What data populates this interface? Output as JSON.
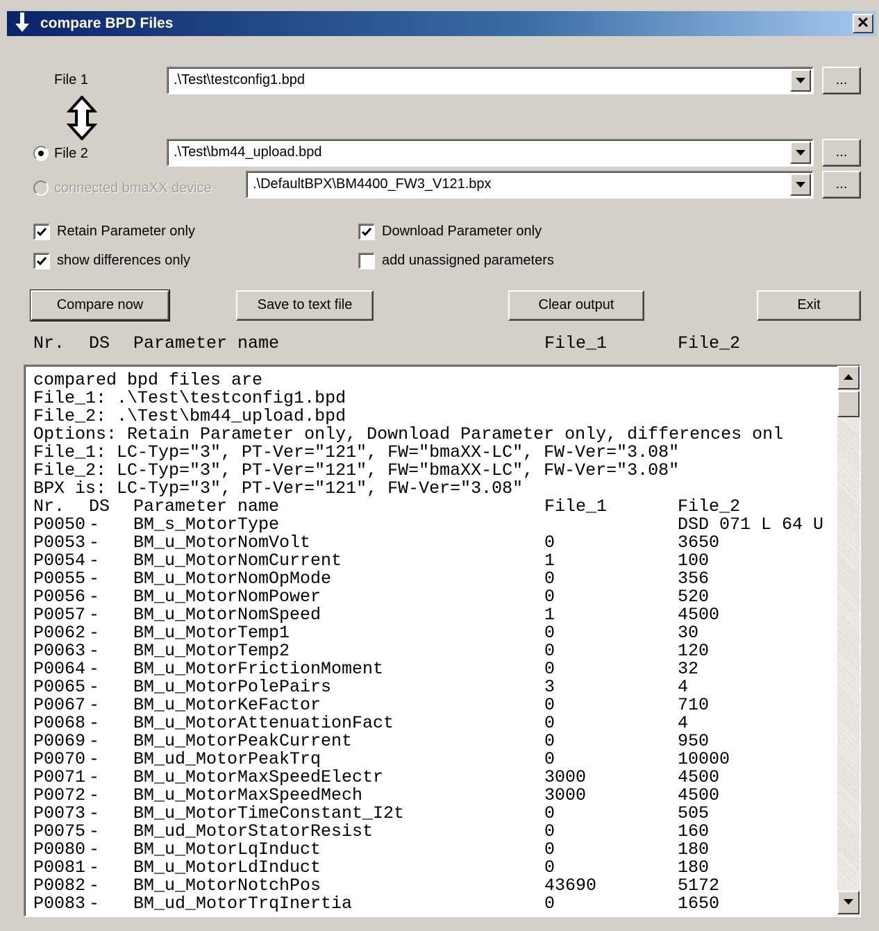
{
  "window": {
    "title": "compare BPD Files",
    "close_label": "✕"
  },
  "file1": {
    "label": "File 1",
    "value": ".\\Test\\testconfig1.bpd",
    "browse_label": "..."
  },
  "file2": {
    "label": "File 2",
    "value": ".\\Test\\bm44_upload.bpd",
    "browse_label": "...",
    "selected": true
  },
  "device": {
    "label": "connected bmaXX device",
    "value": ".\\DefaultBPX\\BM4400_FW3_V121.bpx",
    "browse_label": "...",
    "enabled": false
  },
  "options": {
    "retain": {
      "label": "Retain Parameter only",
      "checked": true
    },
    "download": {
      "label": "Download Parameter only",
      "checked": true
    },
    "differences": {
      "label": "show differences only",
      "checked": true
    },
    "unassigned": {
      "label": "add unassigned parameters",
      "checked": false
    }
  },
  "buttons": {
    "compare": "Compare now",
    "save": "Save to text file",
    "clear": "Clear output",
    "exit": "Exit"
  },
  "columns": {
    "nr": "Nr.",
    "ds": "DS",
    "name": "Parameter name",
    "file1": "File_1",
    "file2": "File_2"
  },
  "output": {
    "preamble": [
      "compared bpd files are",
      "File_1: .\\Test\\testconfig1.bpd",
      "File_2: .\\Test\\bm44_upload.bpd",
      "Options: Retain Parameter only, Download Parameter only, differences onl",
      "File_1: LC-Typ=\"3\", PT-Ver=\"121\", FW=\"bmaXX-LC\", FW-Ver=\"3.08\"",
      "File_2: LC-Typ=\"3\", PT-Ver=\"121\", FW=\"bmaXX-LC\", FW-Ver=\"3.08\"",
      "BPX is: LC-Typ=\"3\", PT-Ver=\"121\", FW-Ver=\"3.08\""
    ],
    "header": {
      "nr": "Nr.",
      "ds": "DS",
      "name": "Parameter name",
      "file1": "File_1",
      "file2": "File_2"
    },
    "rows": [
      {
        "nr": "P0050",
        "ds": "-",
        "name": "BM_s_MotorType",
        "file1": "",
        "file2": "DSD 071 L 64 U"
      },
      {
        "nr": "P0053",
        "ds": "-",
        "name": "BM_u_MotorNomVolt",
        "file1": "0",
        "file2": "3650"
      },
      {
        "nr": "P0054",
        "ds": "-",
        "name": "BM_u_MotorNomCurrent",
        "file1": "1",
        "file2": "100"
      },
      {
        "nr": "P0055",
        "ds": "-",
        "name": "BM_u_MotorNomOpMode",
        "file1": "0",
        "file2": "356"
      },
      {
        "nr": "P0056",
        "ds": "-",
        "name": "BM_u_MotorNomPower",
        "file1": "0",
        "file2": "520"
      },
      {
        "nr": "P0057",
        "ds": "-",
        "name": "BM_u_MotorNomSpeed",
        "file1": "1",
        "file2": "4500"
      },
      {
        "nr": "P0062",
        "ds": "-",
        "name": "BM_u_MotorTemp1",
        "file1": "0",
        "file2": "30"
      },
      {
        "nr": "P0063",
        "ds": "-",
        "name": "BM_u_MotorTemp2",
        "file1": "0",
        "file2": "120"
      },
      {
        "nr": "P0064",
        "ds": "-",
        "name": "BM_u_MotorFrictionMoment",
        "file1": "0",
        "file2": "32"
      },
      {
        "nr": "P0065",
        "ds": "-",
        "name": "BM_u_MotorPolePairs",
        "file1": "3",
        "file2": "4"
      },
      {
        "nr": "P0067",
        "ds": "-",
        "name": "BM_u_MotorKeFactor",
        "file1": "0",
        "file2": "710"
      },
      {
        "nr": "P0068",
        "ds": "-",
        "name": "BM_u_MotorAttenuationFact",
        "file1": "0",
        "file2": "4"
      },
      {
        "nr": "P0069",
        "ds": "-",
        "name": "BM_u_MotorPeakCurrent",
        "file1": "0",
        "file2": "950"
      },
      {
        "nr": "P0070",
        "ds": "-",
        "name": "BM_ud_MotorPeakTrq",
        "file1": "0",
        "file2": "10000"
      },
      {
        "nr": "P0071",
        "ds": "-",
        "name": "BM_u_MotorMaxSpeedElectr",
        "file1": "3000",
        "file2": "4500"
      },
      {
        "nr": "P0072",
        "ds": "-",
        "name": "BM_u_MotorMaxSpeedMech",
        "file1": "3000",
        "file2": "4500"
      },
      {
        "nr": "P0073",
        "ds": "-",
        "name": "BM_u_MotorTimeConstant_I2t",
        "file1": "0",
        "file2": "505"
      },
      {
        "nr": "P0075",
        "ds": "-",
        "name": "BM_ud_MotorStatorResist",
        "file1": "0",
        "file2": "160"
      },
      {
        "nr": "P0080",
        "ds": "-",
        "name": "BM_u_MotorLqInduct",
        "file1": "0",
        "file2": "180"
      },
      {
        "nr": "P0081",
        "ds": "-",
        "name": "BM_u_MotorLdInduct",
        "file1": "0",
        "file2": "180"
      },
      {
        "nr": "P0082",
        "ds": "-",
        "name": "BM_u_MotorNotchPos",
        "file1": "43690",
        "file2": "5172"
      },
      {
        "nr": "P0083",
        "ds": "-",
        "name": "BM_ud_MotorTrqInertia",
        "file1": "0",
        "file2": "1650"
      }
    ]
  }
}
